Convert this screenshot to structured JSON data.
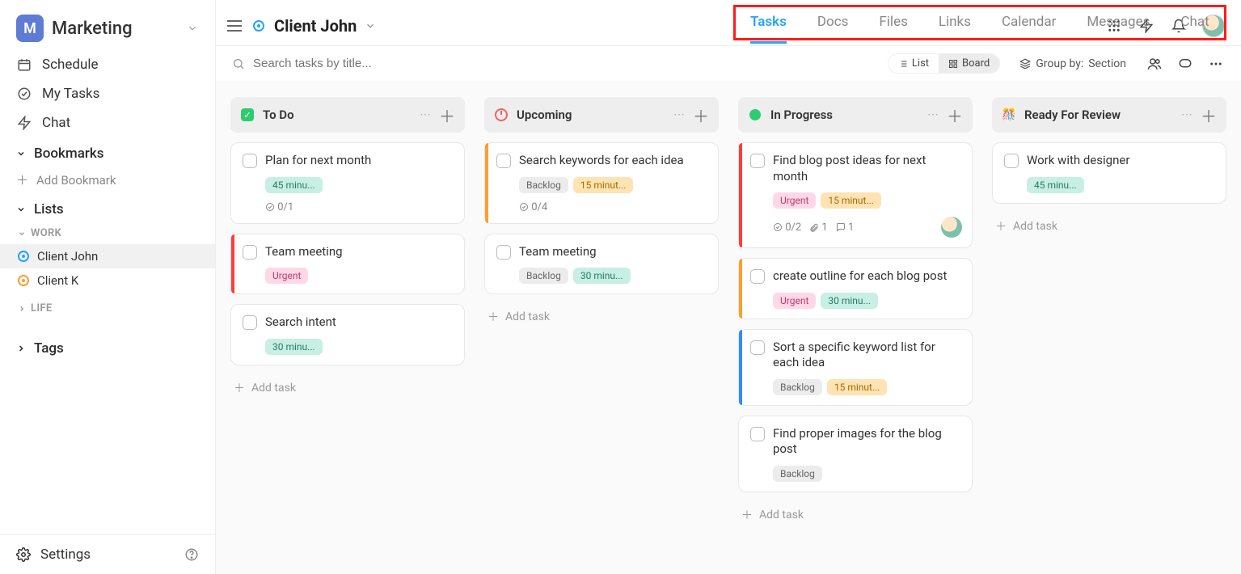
{
  "workspace": {
    "badge": "M",
    "name": "Marketing"
  },
  "sidebar": {
    "schedule": "Schedule",
    "mytasks": "My Tasks",
    "chat": "Chat",
    "bookmarks": "Bookmarks",
    "add_bookmark": "Add Bookmark",
    "lists": "Lists",
    "groups": {
      "work": "WORK",
      "life": "LIFE"
    },
    "list_items": {
      "client_john": "Client John",
      "client_k": "Client K"
    },
    "tags": "Tags",
    "settings": "Settings"
  },
  "header": {
    "title": "Client John",
    "tabs": {
      "tasks": "Tasks",
      "docs": "Docs",
      "files": "Files",
      "links": "Links",
      "calendar": "Calendar",
      "messages": "Messages",
      "chat": "Chat"
    }
  },
  "toolbar": {
    "search_placeholder": "Search tasks by title...",
    "list": "List",
    "board": "Board",
    "groupby_label": "Group by:",
    "groupby_value": "Section"
  },
  "columns": [
    {
      "key": "todo",
      "title": "To Do",
      "icon": "check-green",
      "cards": [
        {
          "title": "Plan for next month",
          "badges": [
            {
              "text": "45 minu...",
              "cls": "teal"
            }
          ],
          "meta": {
            "sub": "0/1"
          }
        },
        {
          "title": "Team meeting",
          "accent": "#ff3b3b",
          "badges": [
            {
              "text": "Urgent",
              "cls": "pink"
            }
          ]
        },
        {
          "title": "Search intent",
          "badges": [
            {
              "text": "30 minu...",
              "cls": "teal"
            }
          ]
        }
      ],
      "add": "Add task"
    },
    {
      "key": "upcoming",
      "title": "Upcoming",
      "icon": "clock-red",
      "cards": [
        {
          "title": "Search keywords for each idea",
          "accent": "#ff9d2e",
          "badges": [
            {
              "text": "Backlog",
              "cls": "gray"
            },
            {
              "text": "15 minut...",
              "cls": "orange"
            }
          ],
          "meta": {
            "sub": "0/4"
          }
        },
        {
          "title": "Team meeting",
          "badges": [
            {
              "text": "Backlog",
              "cls": "gray"
            },
            {
              "text": "30 minu...",
              "cls": "teal"
            }
          ]
        }
      ],
      "add": "Add task"
    },
    {
      "key": "inprogress",
      "title": "In Progress",
      "icon": "dot-green",
      "cards": [
        {
          "title": "Find blog post ideas for next month",
          "accent": "#ff3b3b",
          "badges": [
            {
              "text": "Urgent",
              "cls": "pink"
            },
            {
              "text": "15 minut...",
              "cls": "orange"
            }
          ],
          "meta": {
            "sub": "0/2",
            "attach": "1",
            "comments": "1",
            "avatar": true
          }
        },
        {
          "title": "create outline for each blog post",
          "accent": "#ff9d2e",
          "badges": [
            {
              "text": "Urgent",
              "cls": "pink"
            },
            {
              "text": "30 minu...",
              "cls": "teal"
            }
          ]
        },
        {
          "title": "Sort a specific keyword list for each idea",
          "accent": "#2d8cff",
          "badges": [
            {
              "text": "Backlog",
              "cls": "gray"
            },
            {
              "text": "15 minut...",
              "cls": "orange"
            }
          ]
        },
        {
          "title": "Find proper images for the blog post",
          "badges": [
            {
              "text": "Backlog",
              "cls": "gray"
            }
          ]
        }
      ],
      "add": "Add task"
    },
    {
      "key": "ready",
      "title": "Ready For Review",
      "icon": "confetti",
      "cards": [
        {
          "title": "Work with designer",
          "badges": [
            {
              "text": "45 minu...",
              "cls": "teal"
            }
          ]
        }
      ],
      "add": "Add task"
    }
  ]
}
